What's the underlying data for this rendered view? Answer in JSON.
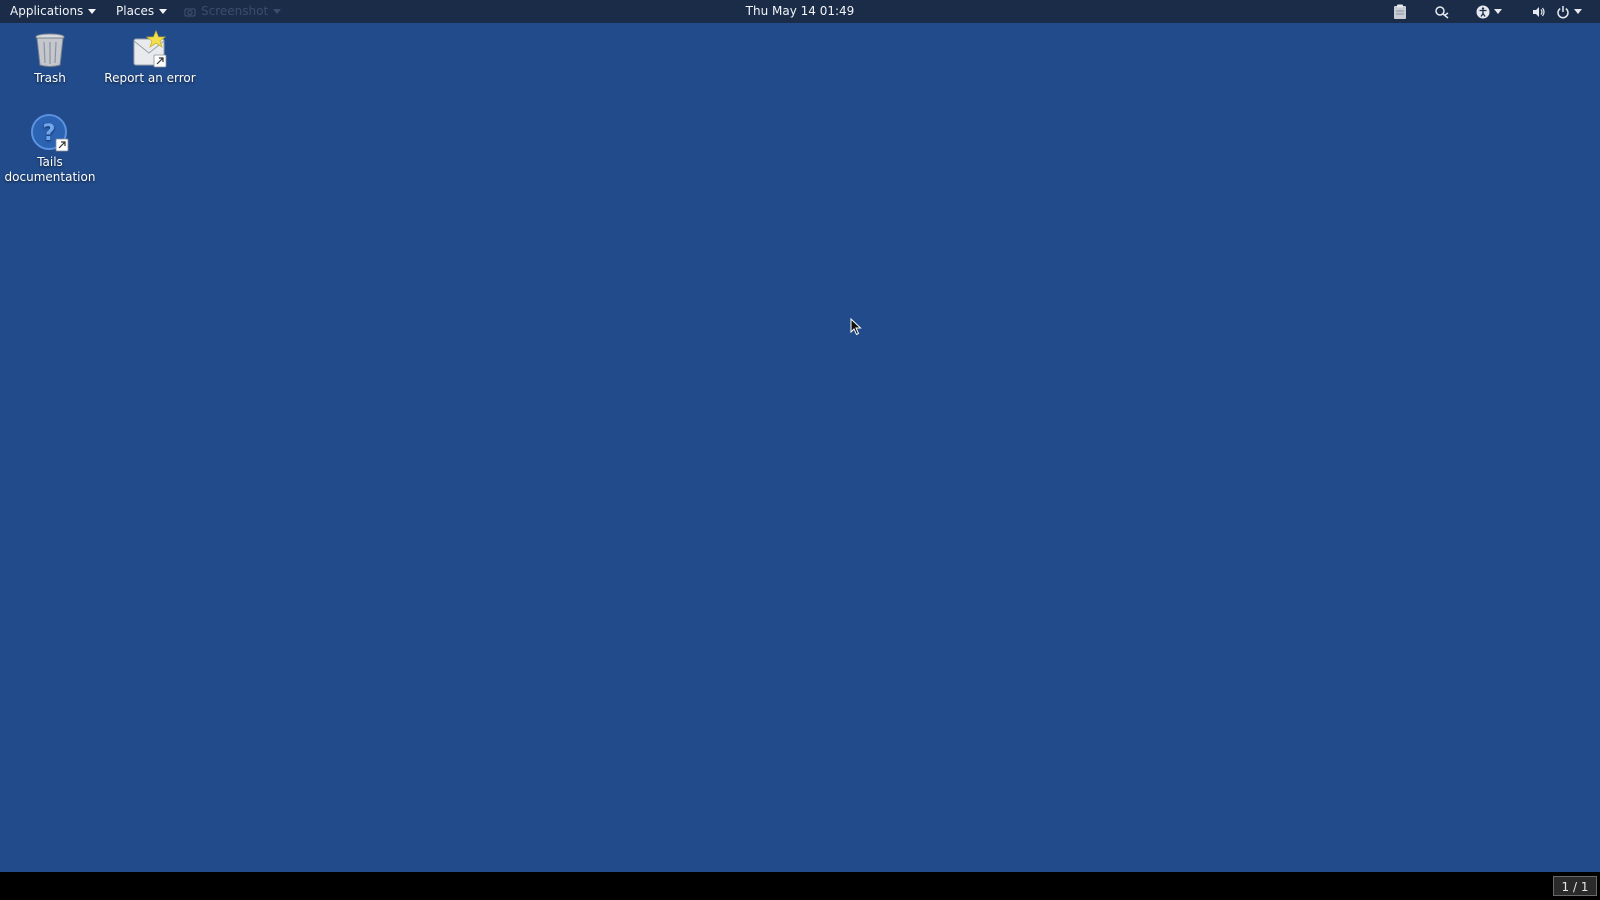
{
  "top_panel": {
    "applications_label": "Applications",
    "places_label": "Places",
    "screenshot_label": "Screenshot",
    "clock": "Thu May 14  01:49",
    "tray_icons": [
      "clipboard-icon",
      "network-icon",
      "accessibility-icon",
      "volume-icon",
      "power-icon"
    ]
  },
  "desktop": {
    "background_color": "#214b8a",
    "icons": [
      {
        "label": "Trash",
        "icon": "trash-icon"
      },
      {
        "label": "Report an error",
        "icon": "report-error-icon"
      },
      {
        "label": "Tails documentation",
        "icon": "help-icon"
      }
    ]
  },
  "bottom_panel": {
    "workspace_label": "1 / 1"
  }
}
